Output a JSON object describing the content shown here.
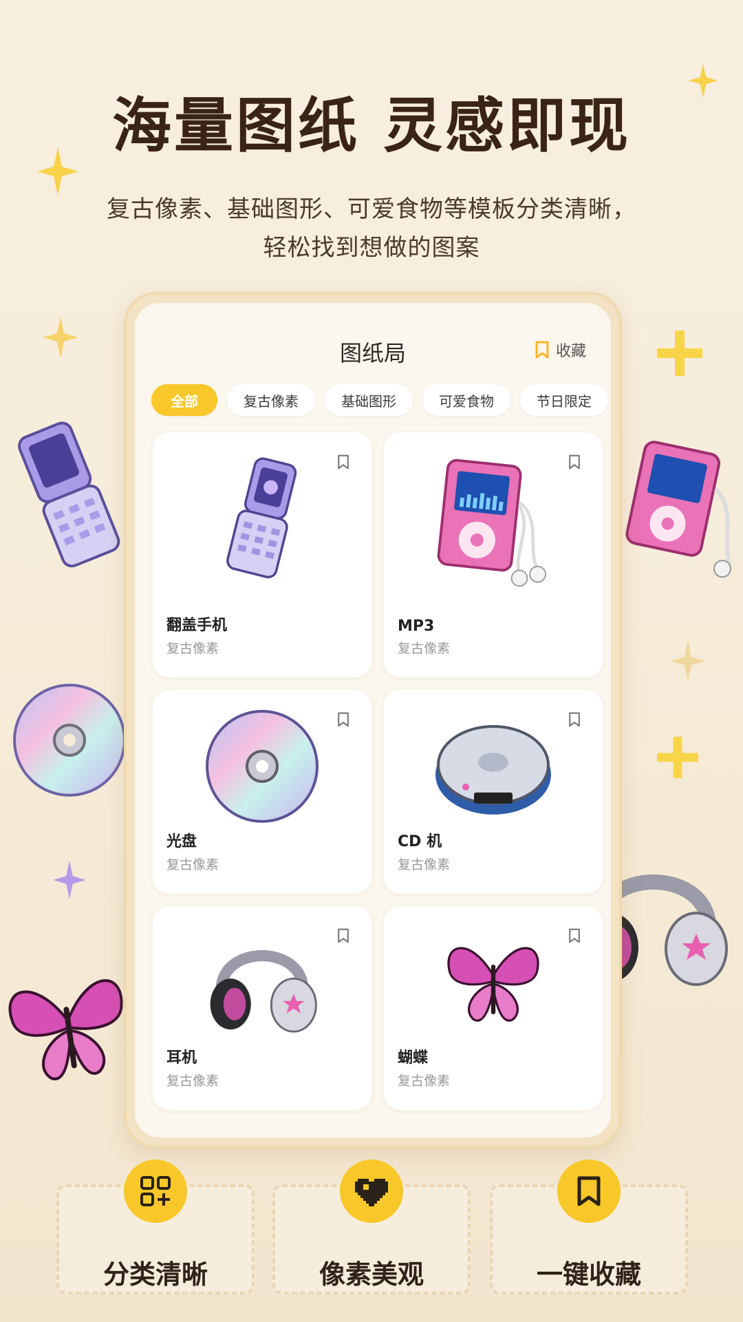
{
  "hero": {
    "title": "海量图纸 灵感即现",
    "subtitle_line1": "复古像素、基础图形、可爱食物等模板分类清晰，",
    "subtitle_line2": "轻松找到想做的图案"
  },
  "app": {
    "title": "图纸局",
    "favorite_label": "收藏",
    "chips": [
      {
        "label": "全部",
        "active": true
      },
      {
        "label": "复古像素",
        "active": false
      },
      {
        "label": "基础图形",
        "active": false
      },
      {
        "label": "可爱食物",
        "active": false
      },
      {
        "label": "节日限定",
        "active": false
      }
    ],
    "cards": [
      {
        "name": "翻盖手机",
        "category": "复古像素",
        "icon": "flip-phone-icon"
      },
      {
        "name": "MP3",
        "category": "复古像素",
        "icon": "mp3-player-icon"
      },
      {
        "name": "光盘",
        "category": "复古像素",
        "icon": "cd-disc-icon"
      },
      {
        "name": "CD 机",
        "category": "复古像素",
        "icon": "cd-player-icon"
      },
      {
        "name": "耳机",
        "category": "复古像素",
        "icon": "headphones-icon"
      },
      {
        "name": "蝴蝶",
        "category": "复古像素",
        "icon": "butterfly-icon"
      }
    ]
  },
  "features": [
    {
      "label": "分类清晰",
      "icon": "category-grid-icon"
    },
    {
      "label": "像素美观",
      "icon": "pixel-heart-icon"
    },
    {
      "label": "一键收藏",
      "icon": "bookmark-icon"
    }
  ],
  "colors": {
    "accent": "#f8c82a",
    "background": "#f8efe0",
    "title": "#3a2415"
  }
}
